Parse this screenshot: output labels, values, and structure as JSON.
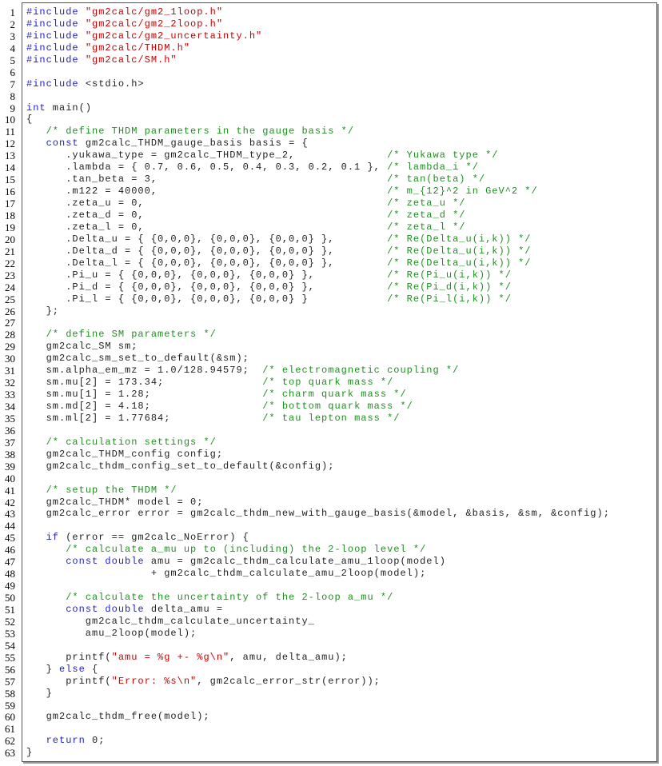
{
  "code": {
    "lines": [
      [
        [
          "k",
          "#include "
        ],
        [
          "s",
          "\"gm2calc/gm2_1loop.h\""
        ]
      ],
      [
        [
          "k",
          "#include "
        ],
        [
          "s",
          "\"gm2calc/gm2_2loop.h\""
        ]
      ],
      [
        [
          "k",
          "#include "
        ],
        [
          "s",
          "\"gm2calc/gm2_uncertainty.h\""
        ]
      ],
      [
        [
          "k",
          "#include "
        ],
        [
          "s",
          "\"gm2calc/THDM.h\""
        ]
      ],
      [
        [
          "k",
          "#include "
        ],
        [
          "s",
          "\"gm2calc/SM.h\""
        ]
      ],
      [],
      [
        [
          "k",
          "#include "
        ],
        [
          "p",
          "<stdio.h>"
        ]
      ],
      [],
      [
        [
          "k",
          "int"
        ],
        [
          "p",
          " main()"
        ]
      ],
      [
        [
          "p",
          "{"
        ]
      ],
      [
        [
          "p",
          "   "
        ],
        [
          "c",
          "/* define THDM parameters in the gauge basis */"
        ]
      ],
      [
        [
          "p",
          "   "
        ],
        [
          "k",
          "const"
        ],
        [
          "p",
          " gm2calc_THDM_gauge_basis basis = {"
        ]
      ],
      [
        [
          "p",
          "      .yukawa_type = gm2calc_THDM_type_2,              "
        ],
        [
          "c",
          "/* Yukawa type */"
        ]
      ],
      [
        [
          "p",
          "      .lambda = { 0.7, 0.6, 0.5, 0.4, 0.3, 0.2, 0.1 }, "
        ],
        [
          "c",
          "/* lambda_i */"
        ]
      ],
      [
        [
          "p",
          "      .tan_beta = 3,                                   "
        ],
        [
          "c",
          "/* tan(beta) */"
        ]
      ],
      [
        [
          "p",
          "      .m122 = 40000,                                   "
        ],
        [
          "c",
          "/* m_{12}^2 in GeV^2 */"
        ]
      ],
      [
        [
          "p",
          "      .zeta_u = 0,                                     "
        ],
        [
          "c",
          "/* zeta_u */"
        ]
      ],
      [
        [
          "p",
          "      .zeta_d = 0,                                     "
        ],
        [
          "c",
          "/* zeta_d */"
        ]
      ],
      [
        [
          "p",
          "      .zeta_l = 0,                                     "
        ],
        [
          "c",
          "/* zeta_l */"
        ]
      ],
      [
        [
          "p",
          "      .Delta_u = { {0,0,0}, {0,0,0}, {0,0,0} },        "
        ],
        [
          "c",
          "/* Re(Delta_u(i,k)) */"
        ]
      ],
      [
        [
          "p",
          "      .Delta_d = { {0,0,0}, {0,0,0}, {0,0,0} },        "
        ],
        [
          "c",
          "/* Re(Delta_u(i,k)) */"
        ]
      ],
      [
        [
          "p",
          "      .Delta_l = { {0,0,0}, {0,0,0}, {0,0,0} },        "
        ],
        [
          "c",
          "/* Re(Delta_u(i,k)) */"
        ]
      ],
      [
        [
          "p",
          "      .Pi_u = { {0,0,0}, {0,0,0}, {0,0,0} },           "
        ],
        [
          "c",
          "/* Re(Pi_u(i,k)) */"
        ]
      ],
      [
        [
          "p",
          "      .Pi_d = { {0,0,0}, {0,0,0}, {0,0,0} },           "
        ],
        [
          "c",
          "/* Re(Pi_d(i,k)) */"
        ]
      ],
      [
        [
          "p",
          "      .Pi_l = { {0,0,0}, {0,0,0}, {0,0,0} }            "
        ],
        [
          "c",
          "/* Re(Pi_l(i,k)) */"
        ]
      ],
      [
        [
          "p",
          "   };"
        ]
      ],
      [],
      [
        [
          "p",
          "   "
        ],
        [
          "c",
          "/* define SM parameters */"
        ]
      ],
      [
        [
          "p",
          "   gm2calc_SM sm;"
        ]
      ],
      [
        [
          "p",
          "   gm2calc_sm_set_to_default(&sm);"
        ]
      ],
      [
        [
          "p",
          "   sm.alpha_em_mz = 1.0/128.94579;  "
        ],
        [
          "c",
          "/* electromagnetic coupling */"
        ]
      ],
      [
        [
          "p",
          "   sm.mu[2] = 173.34;               "
        ],
        [
          "c",
          "/* top quark mass */"
        ]
      ],
      [
        [
          "p",
          "   sm.mu[1] = 1.28;                 "
        ],
        [
          "c",
          "/* charm quark mass */"
        ]
      ],
      [
        [
          "p",
          "   sm.md[2] = 4.18;                 "
        ],
        [
          "c",
          "/* bottom quark mass */"
        ]
      ],
      [
        [
          "p",
          "   sm.ml[2] = 1.77684;              "
        ],
        [
          "c",
          "/* tau lepton mass */"
        ]
      ],
      [],
      [
        [
          "p",
          "   "
        ],
        [
          "c",
          "/* calculation settings */"
        ]
      ],
      [
        [
          "p",
          "   gm2calc_THDM_config config;"
        ]
      ],
      [
        [
          "p",
          "   gm2calc_thdm_config_set_to_default(&config);"
        ]
      ],
      [],
      [
        [
          "p",
          "   "
        ],
        [
          "c",
          "/* setup the THDM */"
        ]
      ],
      [
        [
          "p",
          "   gm2calc_THDM* model = 0;"
        ]
      ],
      [
        [
          "p",
          "   gm2calc_error error = gm2calc_thdm_new_with_gauge_basis(&model, &basis, &sm, &config);"
        ]
      ],
      [],
      [
        [
          "p",
          "   "
        ],
        [
          "k",
          "if"
        ],
        [
          "p",
          " (error == gm2calc_NoError) {"
        ]
      ],
      [
        [
          "p",
          "      "
        ],
        [
          "c",
          "/* calculate a_mu up to (including) the 2-loop level */"
        ]
      ],
      [
        [
          "p",
          "      "
        ],
        [
          "k",
          "const double"
        ],
        [
          "p",
          " amu = gm2calc_thdm_calculate_amu_1loop(model)"
        ]
      ],
      [
        [
          "p",
          "                   + gm2calc_thdm_calculate_amu_2loop(model);"
        ]
      ],
      [],
      [
        [
          "p",
          "      "
        ],
        [
          "c",
          "/* calculate the uncertainty of the 2-loop a_mu */"
        ]
      ],
      [
        [
          "p",
          "      "
        ],
        [
          "k",
          "const double"
        ],
        [
          "p",
          " delta_amu ="
        ]
      ],
      [
        [
          "p",
          "         gm2calc_thdm_calculate_uncertainty_"
        ]
      ],
      [
        [
          "p",
          "         amu_2loop(model);"
        ]
      ],
      [],
      [
        [
          "p",
          "      printf("
        ],
        [
          "s",
          "\"amu = %g +- %g\\n\""
        ],
        [
          "p",
          ", amu, delta_amu);"
        ]
      ],
      [
        [
          "p",
          "   } "
        ],
        [
          "k",
          "else"
        ],
        [
          "p",
          " {"
        ]
      ],
      [
        [
          "p",
          "      printf("
        ],
        [
          "s",
          "\"Error: %s\\n\""
        ],
        [
          "p",
          ", gm2calc_error_str(error));"
        ]
      ],
      [
        [
          "p",
          "   }"
        ]
      ],
      [],
      [
        [
          "p",
          "   gm2calc_thdm_free(model);"
        ]
      ],
      [],
      [
        [
          "p",
          "   "
        ],
        [
          "k",
          "return"
        ],
        [
          "p",
          " 0;"
        ]
      ],
      [
        [
          "p",
          "}"
        ]
      ]
    ]
  },
  "colors": {
    "keyword": "#2222c8",
    "string": "#c80000",
    "comment": "#1f8f1f"
  }
}
